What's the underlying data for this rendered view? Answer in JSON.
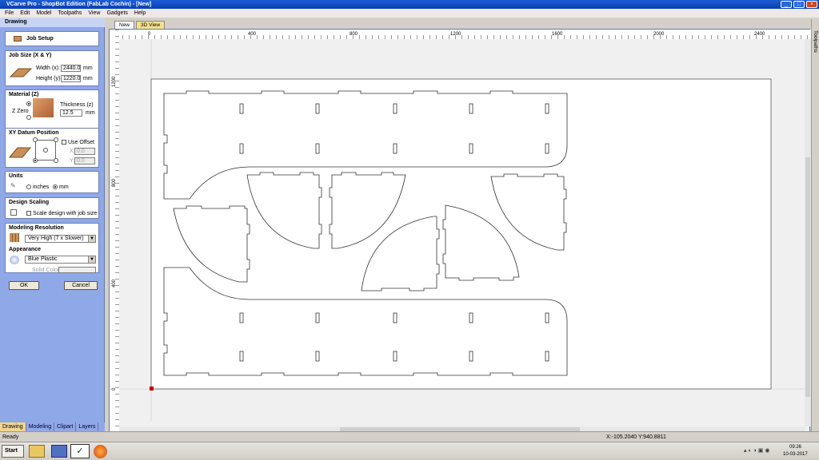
{
  "window": {
    "title": "VCarve Pro - ShopBot Edition (FabLab Cochin) - [New]"
  },
  "menu": [
    "File",
    "Edit",
    "Model",
    "Toolpaths",
    "View",
    "Gadgets",
    "Help"
  ],
  "panel": {
    "title": "Drawing",
    "job_setup": "Job Setup",
    "job_size": {
      "title": "Job Size (X & Y)",
      "width_label": "Width (x):",
      "width_value": "2440.0",
      "height_label": "Height (y):",
      "height_value": "1220.0",
      "unit": "mm"
    },
    "material": {
      "title": "Material (Z)",
      "zero_label": "Z Zero",
      "thickness_label": "Thickness (z)",
      "thickness_value": "12.5",
      "unit": "mm"
    },
    "datum": {
      "title": "XY Datum Position",
      "use_offset": "Use Offset",
      "x_label": "X:",
      "x_value": "0.0",
      "y_label": "Y:",
      "y_value": "0.0"
    },
    "units": {
      "title": "Units",
      "inches": "inches",
      "mm": "mm"
    },
    "scaling": {
      "title": "Design Scaling",
      "label": "Scale design with job size"
    },
    "resolution": {
      "title": "Modeling Resolution",
      "value": "Very High (7 x Slower)"
    },
    "appearance": {
      "title": "Appearance",
      "value": "Blue Plastic",
      "solid_color": "Solid Color:"
    },
    "ok": "OK",
    "cancel": "Cancel"
  },
  "bottom_tabs": [
    "Drawing",
    "Modeling",
    "Clipart",
    "Layers"
  ],
  "doc_tabs": [
    "New",
    "3D View"
  ],
  "ruler": {
    "top": [
      "0",
      "400",
      "800",
      "1200",
      "1600",
      "2000",
      "2400"
    ],
    "left": [
      "1200",
      "800",
      "400",
      "0"
    ]
  },
  "right_toolbar": "Toolpaths",
  "status": {
    "left": "Ready",
    "coords": "X:-105.2040 Y:940.8811"
  },
  "taskbar": {
    "start": "Start",
    "time": "09:26",
    "date": "10-03-2017"
  },
  "colors": {
    "title": "#0a3fb0",
    "panel": "#8fa8e8",
    "accent": "#f4d48c"
  }
}
